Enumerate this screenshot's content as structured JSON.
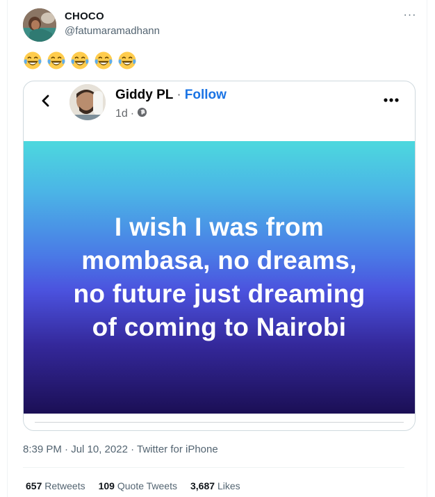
{
  "author": {
    "name": "CHOCO",
    "handle": "@fatumaramadhann"
  },
  "tweet": {
    "emoji_text": "😂😂😂😂😂",
    "emoji_count": 5
  },
  "embedded_post": {
    "name": "Giddy PL",
    "separator": "·",
    "follow_label": "Follow",
    "time": "1d",
    "meta_separator": "·",
    "privacy_icon": "globe-icon",
    "text_lines": [
      "I wish I was from",
      "mombasa, no dreams,",
      "no future just dreaming",
      "of coming to Nairobi"
    ]
  },
  "meta": {
    "timestamp": "8:39 PM · Jul 10, 2022 · Twitter for iPhone"
  },
  "stats": {
    "retweets_count": "657",
    "retweets_label": "Retweets",
    "quotes_count": "109",
    "quotes_label": "Quote Tweets",
    "likes_count": "3,687",
    "likes_label": "Likes"
  },
  "colors": {
    "link": "#1b74e4",
    "secondary_text": "#536471",
    "gradient_top": "#4cd8de",
    "gradient_bottom": "#1b0f55"
  }
}
